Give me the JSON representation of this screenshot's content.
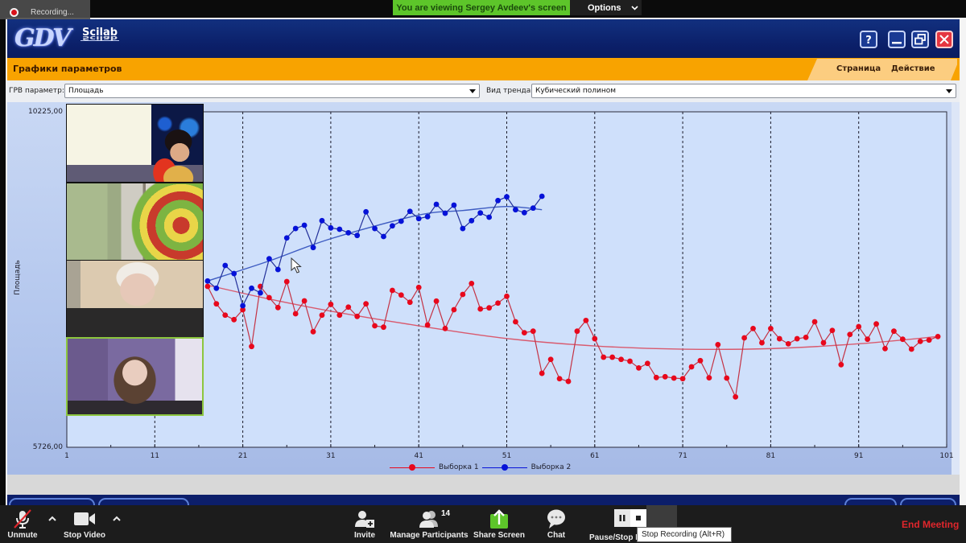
{
  "zoom_top": {
    "recording_label": "Recording...",
    "viewing_banner": "You are viewing Sergey Avdeev's screen",
    "options_label": "Options"
  },
  "app": {
    "logo": "GDV",
    "logo_sub": "Scilab",
    "page_title": "Графики параметров",
    "menu": [
      {
        "label": "Страница"
      },
      {
        "label": "Действие"
      }
    ],
    "window_buttons": {
      "help": "?",
      "minimize": "minimize-icon",
      "restore": "restore-icon",
      "close": "close-icon"
    }
  },
  "params": {
    "grv_label": "ГРВ параметр:",
    "grv_value": "Площадь",
    "trend_label": "Вид тренда",
    "trend_value": "Кубический полином"
  },
  "chart_data": {
    "type": "line",
    "title": "",
    "xlabel": "",
    "ylabel": "Площадь",
    "ylim": [
      5726,
      10225
    ],
    "y_tick_labels": [
      "10225,00",
      "5726,00"
    ],
    "xlim": [
      1,
      101
    ],
    "x_ticks": [
      1,
      11,
      21,
      31,
      41,
      51,
      61,
      71,
      81,
      91,
      101
    ],
    "x_minor_ticks": [
      6,
      16,
      26,
      36,
      46,
      56,
      66,
      76,
      86,
      96
    ],
    "grid": "vertical dashed lines at major x ticks",
    "legend": "bottom-center",
    "series": [
      {
        "name": "Выборка 1",
        "color": "#e8081c",
        "line_color": "#c43244",
        "x_start": 17,
        "values": [
          7884,
          7650,
          7498,
          7438,
          7571,
          7078,
          7884,
          7733,
          7600,
          7948,
          7517,
          7689,
          7276,
          7498,
          7643,
          7498,
          7606,
          7481,
          7650,
          7355,
          7337,
          7830,
          7768,
          7671,
          7870,
          7366,
          7686,
          7319,
          7571,
          7776,
          7923,
          7581,
          7596,
          7660,
          7751,
          7409,
          7262,
          7283,
          6718,
          6905,
          6646,
          6610,
          7283,
          7427,
          7182,
          6934,
          6934,
          6905,
          6880,
          6790,
          6851,
          6661,
          6672,
          6654,
          6646,
          6805,
          6888,
          6658,
          7103,
          6654,
          6402,
          7193,
          7319,
          7128,
          7319,
          7182,
          7114,
          7182,
          7200,
          7409,
          7128,
          7293,
          6834,
          7239,
          7344,
          7175,
          7380,
          7049,
          7283,
          7175,
          7042,
          7146,
          7164,
          7211
        ]
      },
      {
        "name": "Выборка 2",
        "color": "#0612d8",
        "line_color": "#23309a",
        "x_start": 17,
        "values": [
          7956,
          7859,
          8164,
          8056,
          7625,
          7859,
          7797,
          8254,
          8110,
          8534,
          8660,
          8704,
          8405,
          8765,
          8668,
          8650,
          8603,
          8567,
          8884,
          8660,
          8553,
          8696,
          8758,
          8890,
          8793,
          8819,
          8984,
          8865,
          8973,
          8660,
          8765,
          8869,
          8812,
          9035,
          9085,
          8912,
          8873,
          8934,
          9092
        ]
      }
    ],
    "trend_lines": [
      {
        "series": "Выборка 1",
        "kind": "Кубический полином",
        "color": "#d95a6e",
        "points": [
          [
            17,
            7900
          ],
          [
            24,
            7714
          ],
          [
            31,
            7552
          ],
          [
            41,
            7355
          ],
          [
            51,
            7185
          ],
          [
            61,
            7085
          ],
          [
            71,
            7042
          ],
          [
            81,
            7049
          ],
          [
            91,
            7114
          ],
          [
            100,
            7211
          ]
        ]
      },
      {
        "series": "Выборка 2",
        "kind": "Кубический полином",
        "color": "#3e5cc2",
        "points": [
          [
            17,
            7956
          ],
          [
            24,
            8225
          ],
          [
            31,
            8523
          ],
          [
            41,
            8840
          ],
          [
            46,
            8901
          ],
          [
            51,
            8955
          ],
          [
            55,
            8912
          ]
        ]
      }
    ]
  },
  "zoom_toolbar": {
    "unmute": "Unmute",
    "stop_video": "Stop Video",
    "invite": "Invite",
    "manage_participants": "Manage Participants",
    "participants_count": "14",
    "share_screen": "Share Screen",
    "chat": "Chat",
    "pause_stop": "Pause/Stop Recording",
    "tooltip": "Stop Recording (Alt+R)",
    "end_meeting": "End Meeting"
  },
  "colors": {
    "zoom_green": "#5dc52a",
    "end_meeting_red": "#e0262c",
    "app_title_blue": "#12307f",
    "app_orange": "#f8a300"
  }
}
